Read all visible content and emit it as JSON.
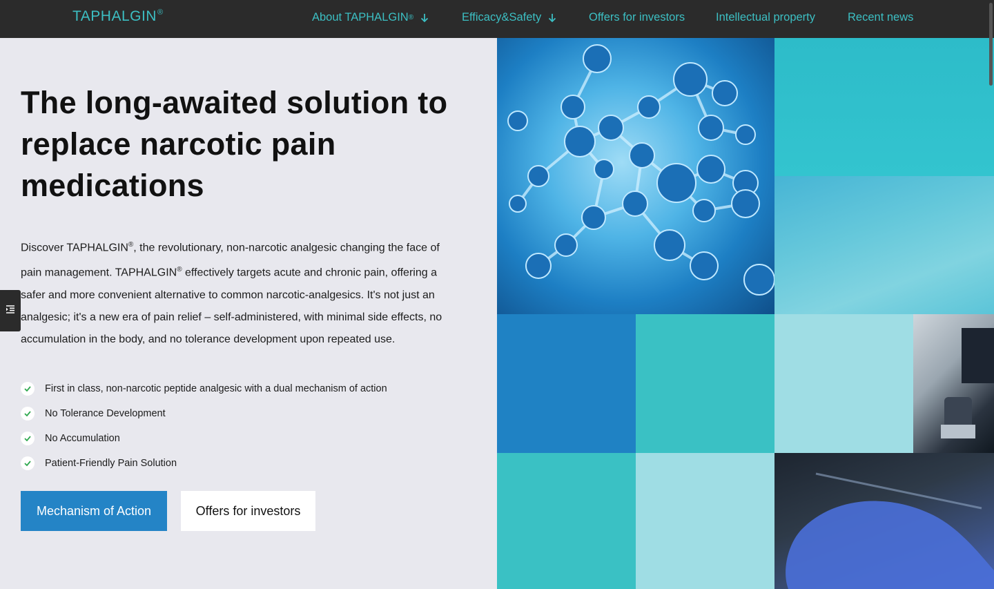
{
  "nav": {
    "logo_text": "TAPHALGIN",
    "logo_sup": "®",
    "items": [
      {
        "label": "About TAPHALGIN",
        "sup": "®",
        "has_dropdown": true
      },
      {
        "label": "Efficacy&Safety",
        "has_dropdown": true
      },
      {
        "label": "Offers for investors"
      },
      {
        "label": "Intellectual property"
      },
      {
        "label": "Recent news"
      }
    ]
  },
  "hero": {
    "headline": "The long-awaited solution to replace narcotic pain medications",
    "intro": {
      "p1": "Discover TAPHALGIN",
      "p2": ", the revolutionary, non-narcotic analgesic changing the face of pain management. TAPHALGIN",
      "p3": " effectively targets acute and chronic pain, offering a safer and more convenient alternative to common narcotic-analgesics. It's not just an analgesic; it's a new era of pain relief – self-administered, with minimal side effects, no accumulation in the body, and no tolerance development upon repeated use.",
      "reg": "®"
    },
    "features": [
      "First in class, non-narcotic peptide analgesic with a dual mechanism of action",
      "No Tolerance Development",
      "No Accumulation",
      "Patient-Friendly Pain Solution"
    ],
    "buttons": {
      "primary": "Mechanism of Action",
      "secondary": "Offers for investors"
    }
  },
  "colors": {
    "nav_bg": "#2b2b2b",
    "accent_teal": "#3cbfc3",
    "primary_blue": "#2484c6",
    "page_bg": "#e8e8ee",
    "check_green": "#2fa84f"
  },
  "icons": {
    "dropdown": "arrow-down-icon",
    "check": "check-icon",
    "side_tab": "list-indent-icon"
  }
}
